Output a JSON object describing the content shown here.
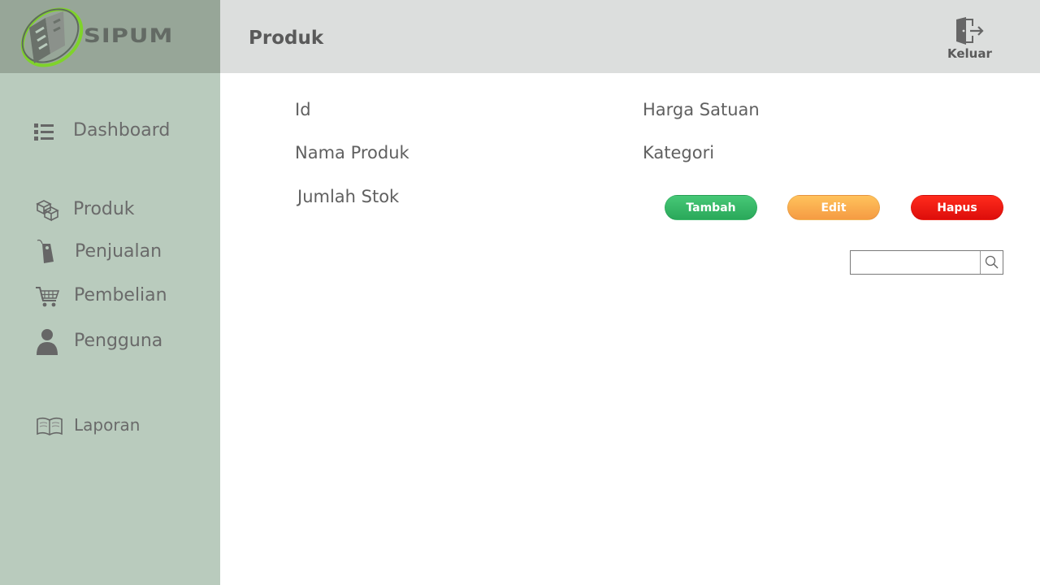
{
  "app": {
    "logo_text": "SIPUM"
  },
  "header": {
    "title": "Produk",
    "logout_label": "Keluar"
  },
  "sidebar": {
    "items": [
      {
        "label": "Dashboard",
        "icon": "list-icon"
      },
      {
        "label": "Produk",
        "icon": "boxes-icon"
      },
      {
        "label": "Penjualan",
        "icon": "tag-icon"
      },
      {
        "label": "Pembelian",
        "icon": "cart-icon"
      },
      {
        "label": "Pengguna",
        "icon": "user-icon"
      },
      {
        "label": "Laporan",
        "icon": "book-icon"
      }
    ]
  },
  "form": {
    "fields": [
      {
        "label": "Id"
      },
      {
        "label": "Harga Satuan"
      },
      {
        "label": "Nama Produk"
      },
      {
        "label": "Kategori"
      },
      {
        "label": "Jumlah Stok"
      }
    ]
  },
  "actions": {
    "add_label": "Tambah",
    "edit_label": "Edit",
    "delete_label": "Hapus"
  },
  "search": {
    "value": "",
    "placeholder": ""
  },
  "colors": {
    "sidebar_bg": "#b9cbbd",
    "logo_bg": "#97a698",
    "header_bg": "#dcdedd",
    "add": "#2fb463",
    "edit": "#f8a84c",
    "delete": "#ee1510"
  }
}
